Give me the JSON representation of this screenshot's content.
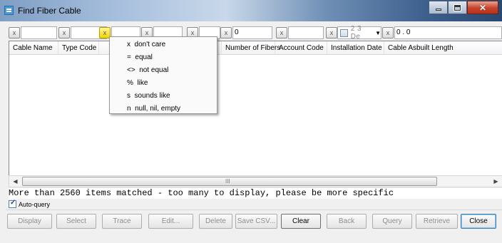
{
  "window": {
    "title": "Find Fiber Cable"
  },
  "filters": [
    {
      "op": "x",
      "value": ""
    },
    {
      "op": "x",
      "value": ""
    },
    {
      "op": "x",
      "value": ""
    },
    {
      "op": "x",
      "value": ""
    },
    {
      "op": "x",
      "value": ""
    },
    {
      "op": "x",
      "value": "0"
    },
    {
      "op": "x",
      "value": ""
    },
    {
      "op": "x",
      "date": "2 3 De"
    },
    {
      "op": "x",
      "value": "0 . 0"
    }
  ],
  "columns": [
    "Cable Name",
    "Type Code",
    "",
    "",
    "",
    "Number of Fibers",
    "Account Code",
    "Installation Date",
    "Cable Asbuilt Length"
  ],
  "scroll_marker": "III",
  "status": "More than 2560 items matched - too many to display, please be more specific",
  "autoquery": {
    "label": "Auto-query",
    "checked": true
  },
  "dropdown": {
    "items": [
      "x  don't care",
      "=  equal",
      "<>  not equal",
      "%  like",
      "s  sounds like",
      "n  null, nil, empty"
    ]
  },
  "buttons": {
    "display": "Display",
    "select": "Select",
    "trace": "Trace",
    "edit": "Edit...",
    "delete": "Delete",
    "save_csv": "Save CSV...",
    "clear": "Clear",
    "back": "Back",
    "query": "Query",
    "retrieve": "Retrieve",
    "close": "Close"
  }
}
